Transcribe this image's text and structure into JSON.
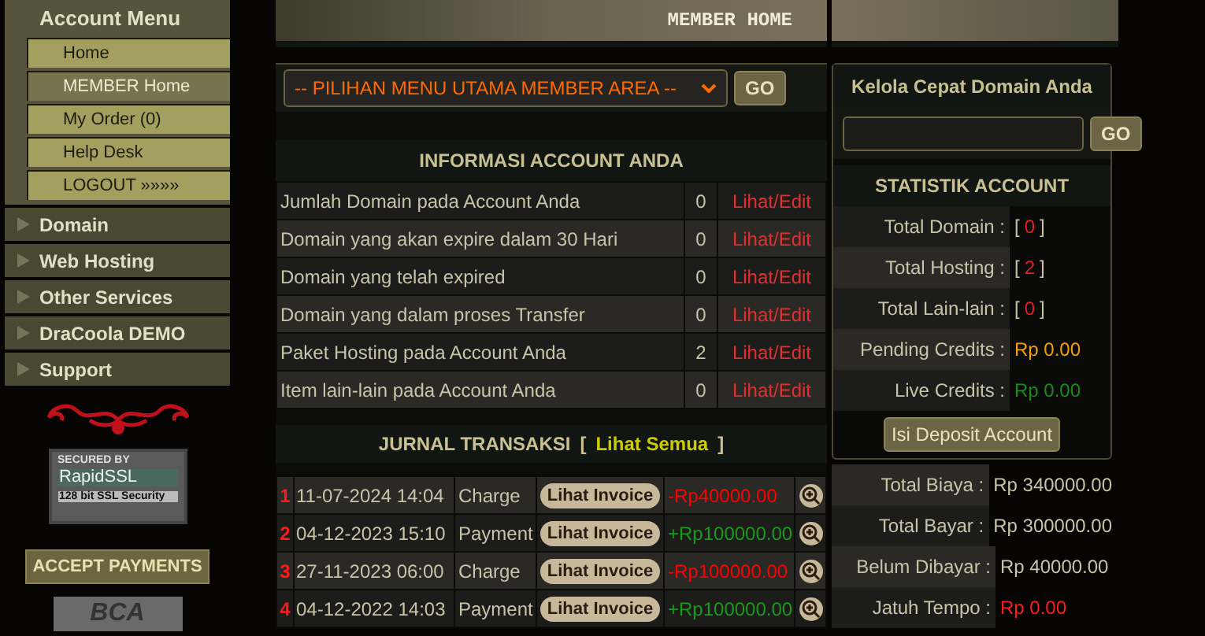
{
  "account_menu": {
    "title": "Account Menu",
    "items": [
      {
        "label": "Home",
        "selected": false
      },
      {
        "label": "MEMBER Home",
        "selected": true
      },
      {
        "label": "My Order (0)",
        "selected": false
      },
      {
        "label": "Help Desk",
        "selected": false
      },
      {
        "label": "LOGOUT »»»»",
        "selected": false
      }
    ]
  },
  "categories": [
    {
      "label": "Domain"
    },
    {
      "label": "Web Hosting"
    },
    {
      "label": "Other Services"
    },
    {
      "label": "DraCoola DEMO"
    },
    {
      "label": "Support"
    }
  ],
  "ssl_badge": {
    "line_1": "SECURED BY",
    "line_2": "RapidSSL",
    "line_3": "128 bit SSL Security"
  },
  "payments_button": "ACCEPT PAYMENTS",
  "bank_logo": "BCA",
  "page_title": "MEMBER HOME",
  "main_menu": {
    "value": "-- PILIHAN MENU UTAMA MEMBER AREA --",
    "button": "GO"
  },
  "account_info": {
    "title": "INFORMASI ACCOUNT ANDA",
    "rows": [
      {
        "label": "Jumlah Domain pada Account Anda",
        "count": "0",
        "link": "Lihat/Edit"
      },
      {
        "label": "Domain yang akan expire dalam 30 Hari",
        "count": "0",
        "link": "Lihat/Edit"
      },
      {
        "label": "Domain yang telah expired",
        "count": "0",
        "link": "Lihat/Edit"
      },
      {
        "label": "Domain yang dalam proses Transfer",
        "count": "0",
        "link": "Lihat/Edit"
      },
      {
        "label": "Paket Hosting pada Account Anda",
        "count": "2",
        "link": "Lihat/Edit"
      },
      {
        "label": "Item lain-lain pada Account Anda",
        "count": "0",
        "link": "Lihat/Edit"
      }
    ]
  },
  "journal": {
    "title": "JURNAL TRANSAKSI",
    "link_open": "[",
    "link": "Lihat Semua",
    "link_close": "]",
    "rows": [
      {
        "number": "1",
        "date": "11-07-2024 14:04",
        "type": "Charge",
        "button": "Lihat Invoice",
        "amount": "-Rp40000.00",
        "color": "#ff0000"
      },
      {
        "number": "2",
        "date": "04-12-2023 15:10",
        "type": "Payment",
        "button": "Lihat Invoice",
        "amount": "+Rp100000.00",
        "color": "#1a9a1a"
      },
      {
        "number": "3",
        "date": "27-11-2023 06:00",
        "type": "Charge",
        "button": "Lihat Invoice",
        "amount": "-Rp100000.00",
        "color": "#ff0000"
      },
      {
        "number": "4",
        "date": "04-12-2022 14:03",
        "type": "Payment",
        "button": "Lihat Invoice",
        "amount": "+Rp100000.00",
        "color": "#1a9a1a"
      }
    ]
  },
  "quick_domain": {
    "title": "Kelola Cepat Domain Anda",
    "button": "GO"
  },
  "statistics": {
    "title": "STATISTIK ACCOUNT",
    "rows": [
      {
        "label": "Total Domain :",
        "prefix": "[",
        "value": "0",
        "suffix": "]",
        "color": "#e02020"
      },
      {
        "label": "Total Hosting :",
        "prefix": "[",
        "value": "2",
        "suffix": "]",
        "color": "#e02020"
      },
      {
        "label": "Total Lain-lain :",
        "prefix": "[",
        "value": "0",
        "suffix": "]",
        "color": "#e02020"
      },
      {
        "label": "Pending Credits :",
        "value": "Rp 0.00",
        "color": "#f5a000"
      },
      {
        "label": "Live Credits :",
        "value": "Rp 0.00",
        "color": "#1a8a1a"
      }
    ],
    "button": "Isi Deposit Account"
  },
  "billing": [
    {
      "label": "Total Biaya :",
      "value": "Rp 340000.00",
      "color": "#c8c4a8"
    },
    {
      "label": "Total Bayar :",
      "value": "Rp 300000.00",
      "color": "#c8c4a8"
    },
    {
      "label": "Belum Dibayar :",
      "value": "Rp 40000.00",
      "color": "#c8c4a8"
    },
    {
      "label": "Jatuh Tempo :",
      "value": "Rp 0.00",
      "color": "#ff1a1a"
    }
  ]
}
